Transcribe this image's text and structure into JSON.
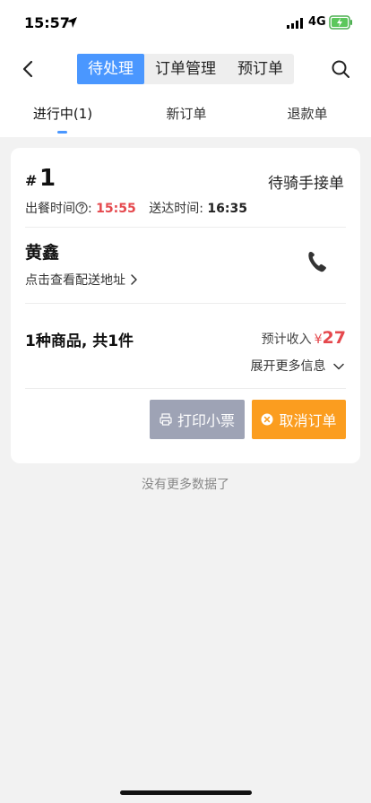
{
  "status_bar": {
    "time": "15:57",
    "network": "4G"
  },
  "nav": {
    "segments": [
      "待处理",
      "订单管理",
      "预订单"
    ],
    "active_segment": "待处理"
  },
  "sub_tabs": [
    "进行中(1)",
    "新订单",
    "退款单"
  ],
  "order": {
    "hash": "#",
    "number": "1",
    "status": "待骑手接单",
    "meal_time_label": "出餐时间",
    "meal_time_colon": ":",
    "meal_time_value": "15:55",
    "delivery_time_label": "送达时间:",
    "delivery_time_value": "16:35",
    "customer_name": "黄鑫",
    "address_link": "点击查看配送地址",
    "items_summary": "1种商品, 共1件",
    "income_label": "预计收入",
    "income_currency": "¥",
    "income_amount": "27",
    "expand_label": "展开更多信息",
    "print_button": "打印小票",
    "cancel_button": "取消订单"
  },
  "footer_text": "没有更多数据了",
  "colors": {
    "accent": "#4a97ff",
    "price_red": "#e5484d",
    "cancel_orange": "#fb9d1f",
    "print_gray": "#9ea3b5"
  }
}
